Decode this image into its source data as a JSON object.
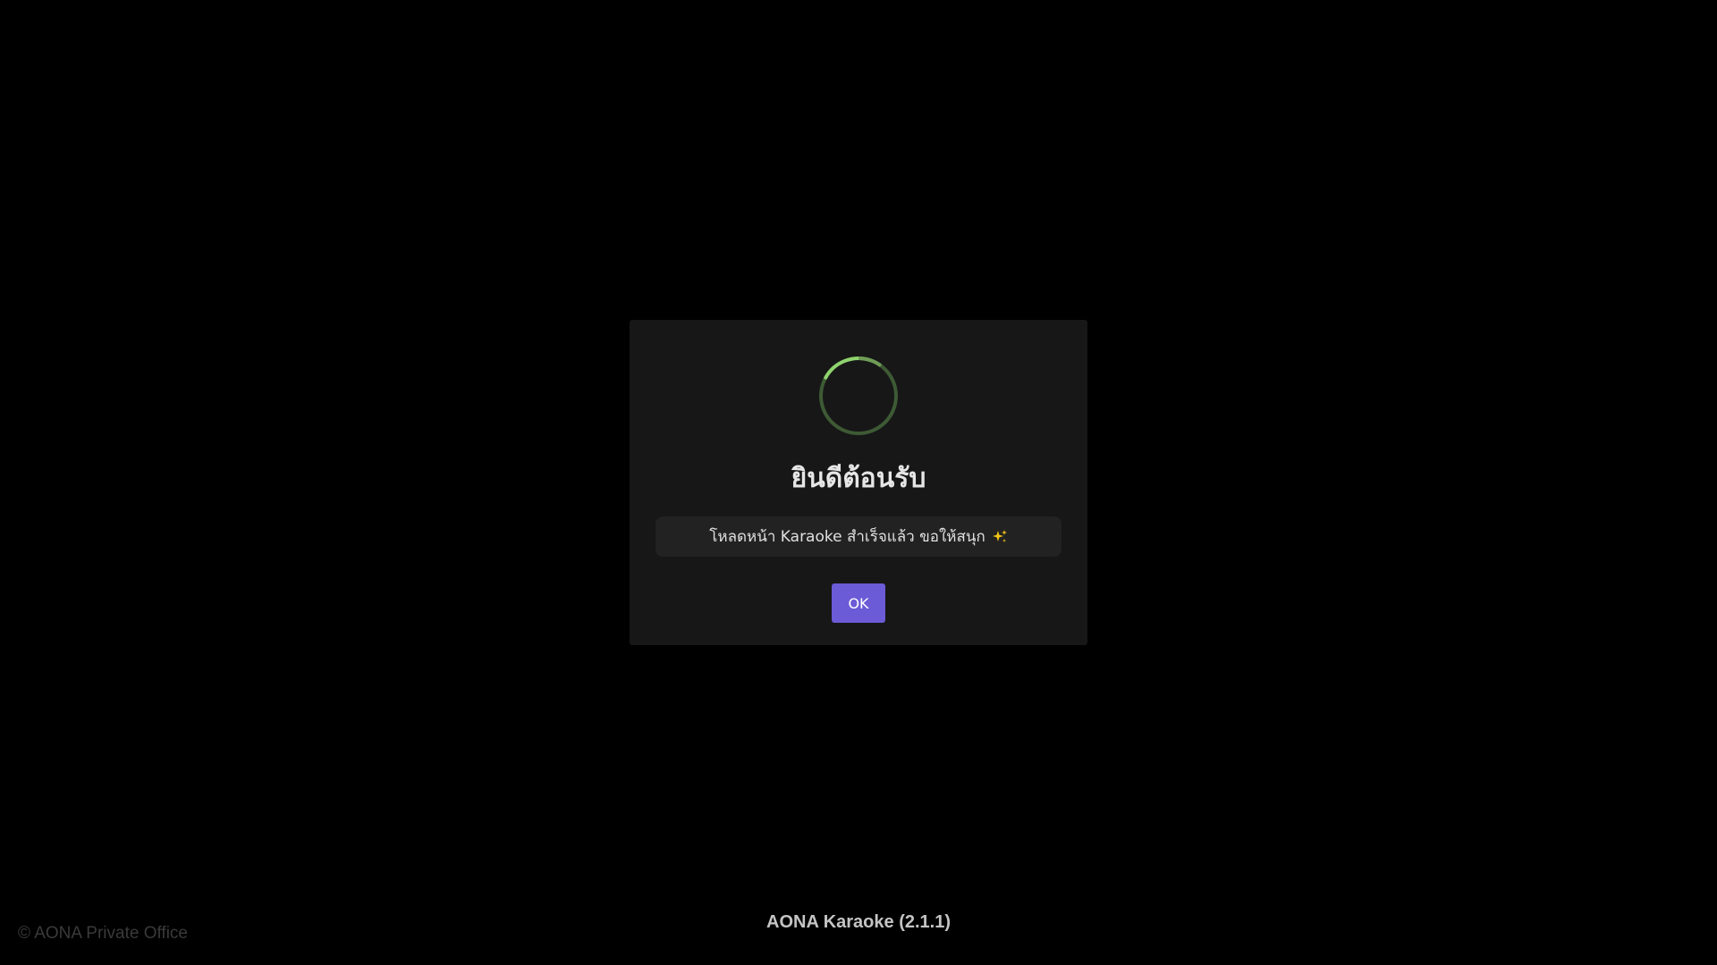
{
  "modal": {
    "title": "ยินดีต้อนรับ",
    "message": "โหลดหน้า Karaoke สำเร็จแล้ว ขอให้สนุก",
    "message_icon": "sparkles-icon",
    "ok_label": "OK",
    "spinner_icon": "loading-spinner-icon"
  },
  "footer": {
    "copyright": "© AONA Private Office",
    "version": "AONA Karaoke (2.1.1)"
  },
  "colors": {
    "background": "#000000",
    "modal_bg": "#171717",
    "message_bg": "#222222",
    "button_accent": "#6b5bd6",
    "spinner_green": "#8fd36e",
    "spinner_track": "#3d5a34",
    "sparkle": "#f5c518"
  }
}
